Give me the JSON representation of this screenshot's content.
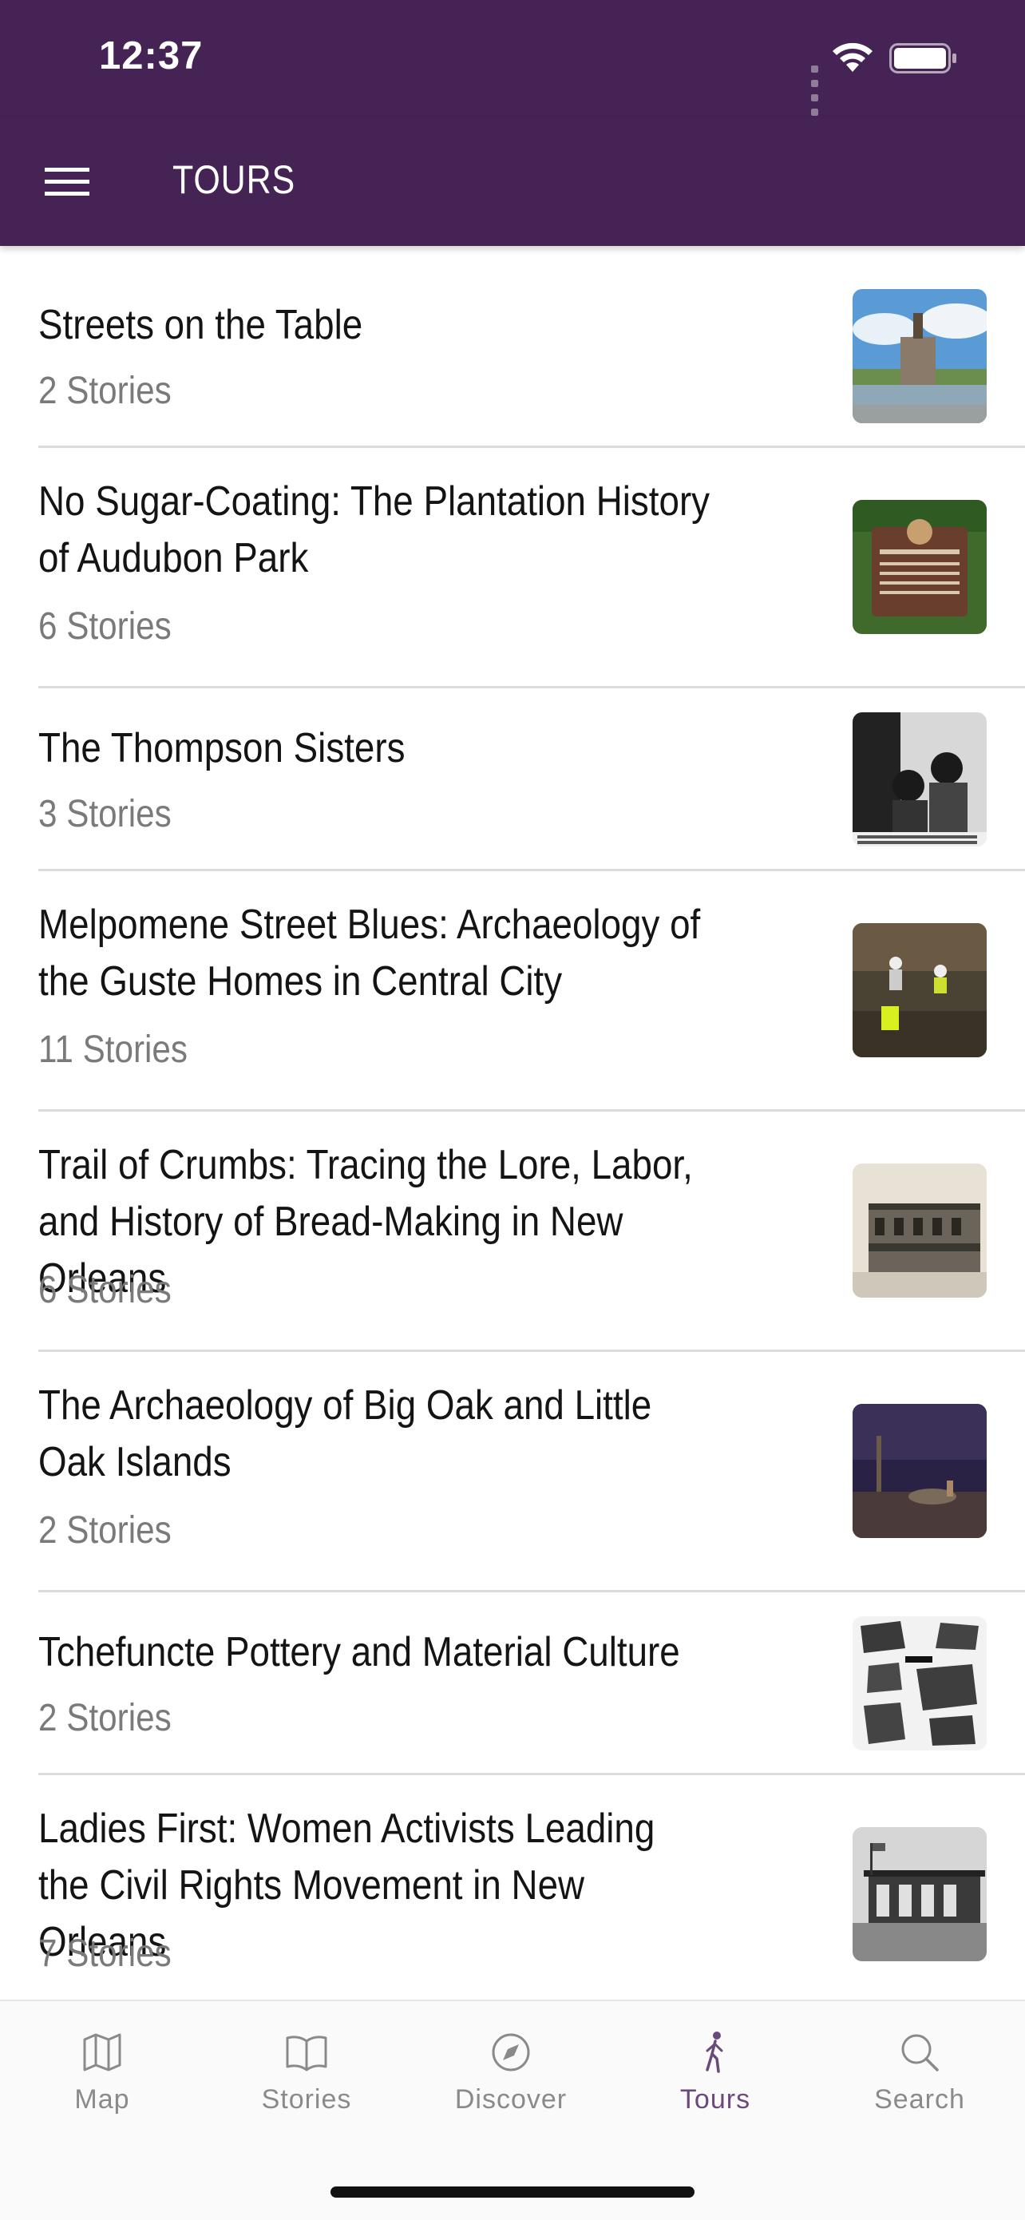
{
  "status": {
    "time": "12:37"
  },
  "header": {
    "title": "TOURS"
  },
  "tours": [
    {
      "title": "Streets on the Table",
      "count": "2 Stories"
    },
    {
      "title": "No Sugar-Coating: The Plantation History of Audubon Park",
      "count": "6 Stories"
    },
    {
      "title": "The Thompson Sisters",
      "count": "3 Stories"
    },
    {
      "title": "Melpomene Street Blues: Archaeology of the Guste Homes in Central City",
      "count": "11 Stories"
    },
    {
      "title": "Trail of Crumbs: Tracing the Lore, Labor, and History of Bread-Making in New Orleans",
      "count": "6 Stories"
    },
    {
      "title": "The Archaeology of Big Oak and Little Oak Islands",
      "count": "2 Stories"
    },
    {
      "title": "Tchefuncte Pottery and Material Culture",
      "count": "2 Stories"
    },
    {
      "title": "Ladies First: Women Activists Leading the Civil Rights Movement in New Orleans",
      "count": "7 Stories"
    }
  ],
  "tabs": {
    "map": "Map",
    "stories": "Stories",
    "discover": "Discover",
    "tours": "Tours",
    "search": "Search",
    "active": "Tours"
  },
  "colors": {
    "header_bg": "#452354",
    "active_tab": "#6a4a7a",
    "inactive_tab": "#8a8a8a"
  }
}
